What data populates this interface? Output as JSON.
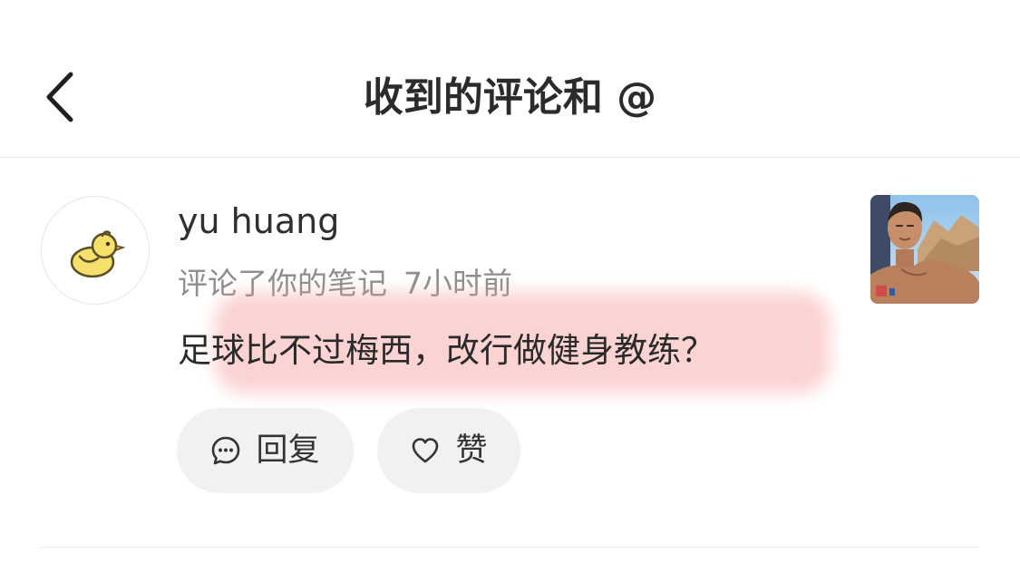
{
  "header": {
    "title": "收到的评论和 @",
    "back_icon": "chevron-left-icon"
  },
  "notification": {
    "user_name": "yu huang",
    "avatar_icon": "yellow-chick-icon",
    "action": "评论了你的笔记",
    "time": "7小时前",
    "comment": "足球比不过梅西，改行做健身教练？",
    "highlight_color": "#f69696",
    "actions": {
      "reply_label": "回复",
      "reply_icon": "comment-bubble-icon",
      "like_label": "赞",
      "like_icon": "heart-icon"
    },
    "note_thumbnail_icon": "note-photo-thumbnail"
  }
}
